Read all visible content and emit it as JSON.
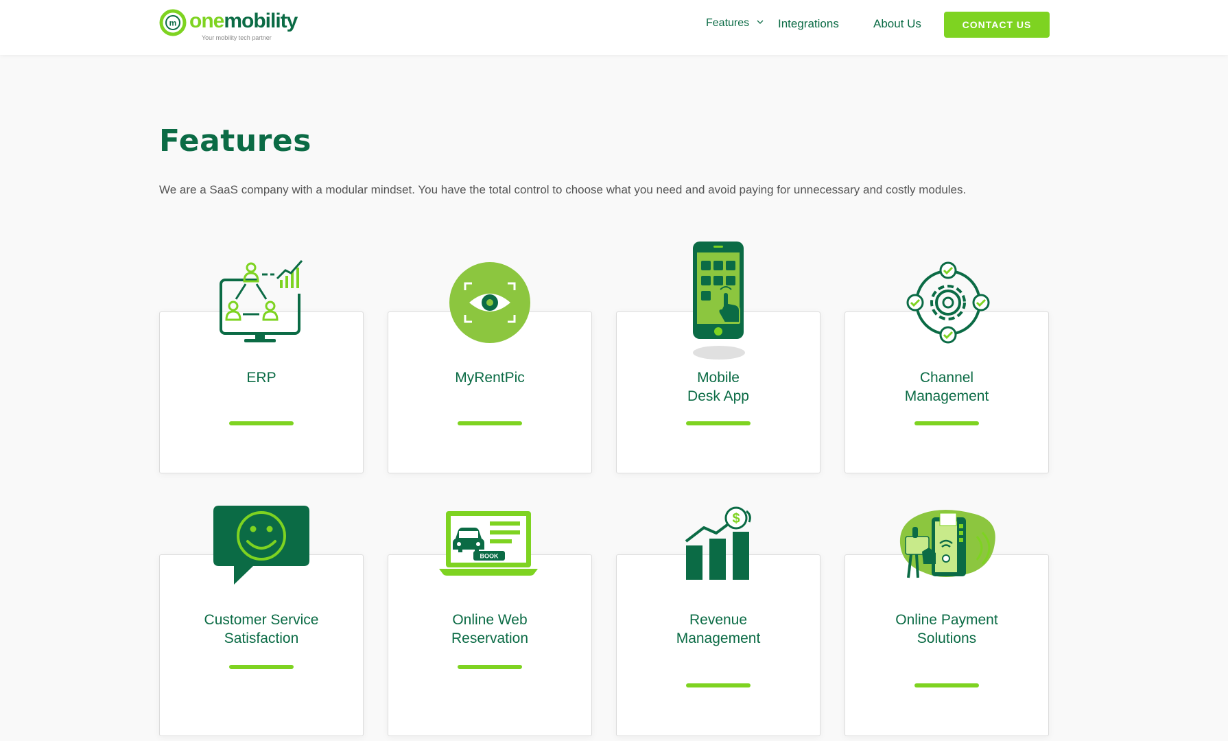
{
  "brand": {
    "logo_one": "one",
    "logo_mobility": "mobility",
    "tagline": "Your mobility tech partner",
    "primary_green": "#7ed321",
    "dark_green": "#0b6b45"
  },
  "nav": {
    "features": "Features",
    "integrations": "Integrations",
    "about": "About Us",
    "contact": "CONTACT US"
  },
  "main": {
    "title": "Features",
    "intro": "We are a SaaS company with a modular mindset. You have the total control to choose what you need and avoid paying for unnecessary and costly modules."
  },
  "features": [
    {
      "line1": "ERP",
      "line2": "",
      "icon": "erp-network-icon"
    },
    {
      "line1": "MyRentPic",
      "line2": "",
      "icon": "eye-scan-icon"
    },
    {
      "line1": "Mobile",
      "line2": "Desk App",
      "icon": "mobile-phone-icon"
    },
    {
      "line1": "Channel",
      "line2": "Management",
      "icon": "gear-channel-icon"
    },
    {
      "line1": "Customer Service",
      "line2": "Satisfaction",
      "icon": "smiley-chat-icon"
    },
    {
      "line1": "Online Web",
      "line2": "Reservation",
      "icon": "laptop-book-icon"
    },
    {
      "line1": "Revenue",
      "line2": "Management",
      "icon": "revenue-chart-icon"
    },
    {
      "line1": "Online Payment",
      "line2": "Solutions",
      "icon": "payment-terminal-icon"
    }
  ],
  "icon_labels": {
    "book": "BOOK",
    "dollar": "$",
    "logo_mark": "m"
  }
}
